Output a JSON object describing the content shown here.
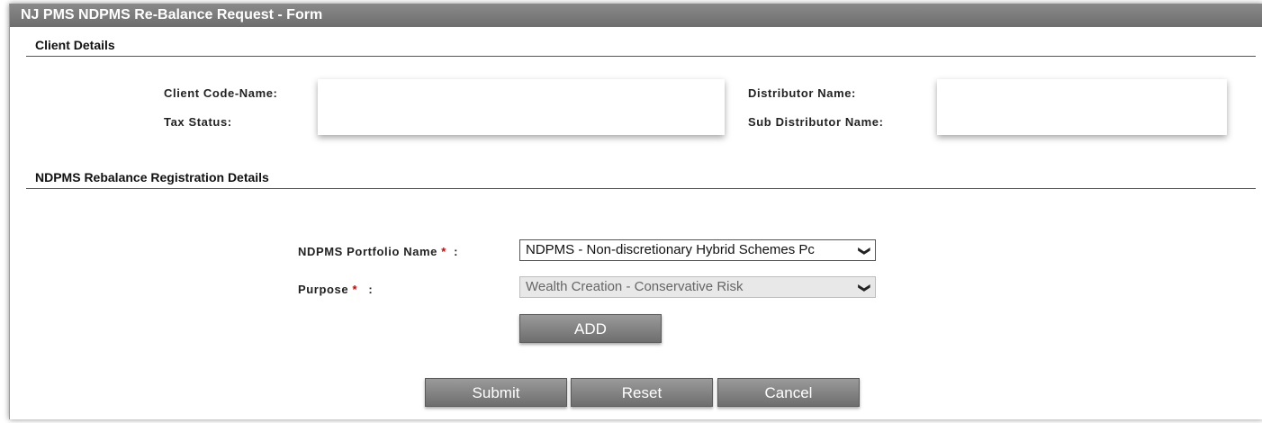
{
  "form": {
    "title": "NJ PMS NDPMS Re-Balance Request - Form"
  },
  "client_details": {
    "section_title": "Client Details",
    "client_code_label": "Client Code-Name:",
    "tax_status_label": "Tax Status:",
    "distributor_label": "Distributor Name:",
    "sub_distributor_label": "Sub Distributor Name:"
  },
  "registration": {
    "section_title": "NDPMS Rebalance Registration Details",
    "portfolio_label": "NDPMS Portfolio Name",
    "portfolio_value": "NDPMS - Non-discretionary Hybrid Schemes Pc",
    "purpose_label": "Purpose",
    "purpose_value": "Wealth Creation - Conservative Risk",
    "required_mark": "*",
    "colon": ":",
    "add_label": "ADD"
  },
  "actions": {
    "submit_label": "Submit",
    "reset_label": "Reset",
    "cancel_label": "Cancel"
  },
  "icons": {
    "dropdown": "chevron-down-icon"
  }
}
